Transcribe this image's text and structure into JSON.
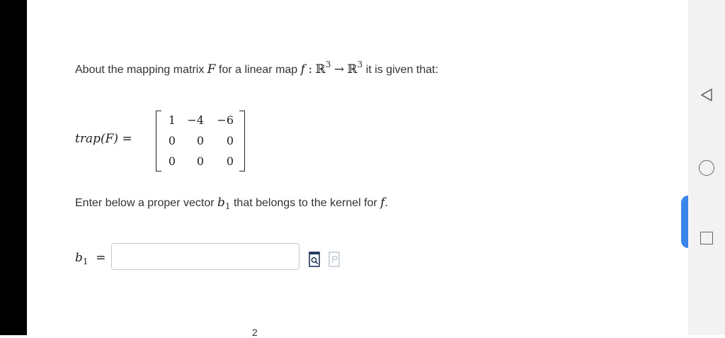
{
  "question": {
    "prefix": "About the mapping matrix",
    "matrix_var": "F",
    "mid": "for a linear map",
    "map_name": "f",
    "colon": ":",
    "domain": "ℝ",
    "domain_exp": "3",
    "arrow": "→",
    "codomain": "ℝ",
    "codomain_exp": "3",
    "suffix": "it is given that:"
  },
  "equation": {
    "label": "trap(F) =",
    "matrix": [
      [
        "1",
        "−4",
        "−6"
      ],
      [
        "0",
        "0",
        "0"
      ],
      [
        "0",
        "0",
        "0"
      ]
    ]
  },
  "instruction": {
    "prefix": "Enter below a proper vector",
    "vec": "b",
    "vec_sub": "1",
    "mid": "that belongs to the kernel for",
    "map_name": "f",
    "end": "."
  },
  "answer": {
    "var": "b",
    "sub": "1",
    "eq": "=",
    "value": ""
  },
  "icons": {
    "preview": "preview-icon",
    "formula": "formula-icon",
    "back": "back-triangle-icon",
    "home": "home-circle-icon",
    "recent": "recent-square-icon"
  },
  "colors": {
    "accent": "#3a86e8",
    "icon_dark": "#1d3557",
    "nav_bar": "#f2f2f2"
  },
  "bottom_partial_text": "2"
}
